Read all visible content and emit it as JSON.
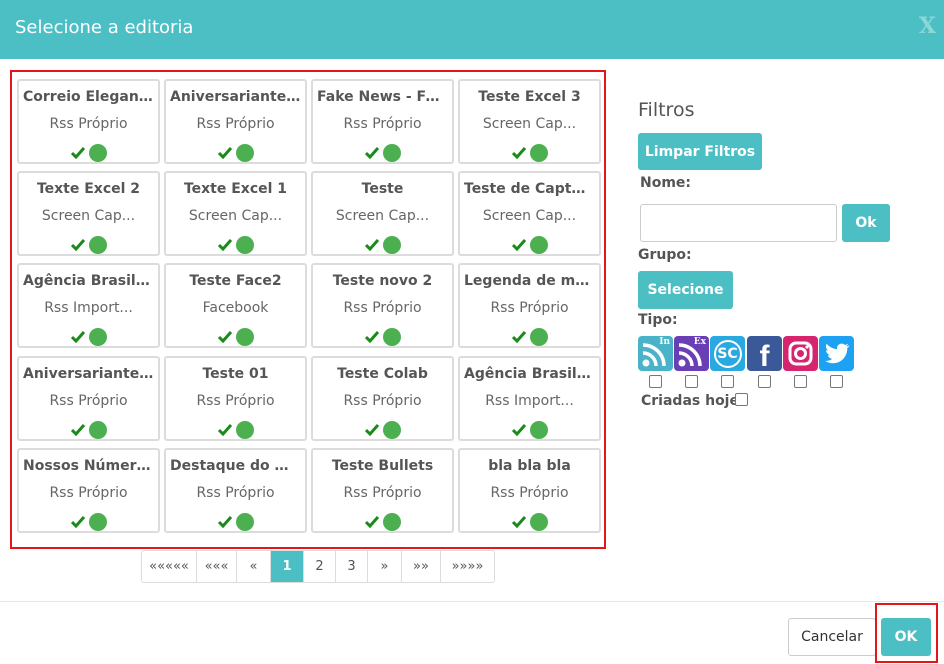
{
  "dialog": {
    "title": "Selecione a editoria",
    "close_label": "X"
  },
  "colors": {
    "accent": "#4bbfc3",
    "highlight": "#e4161b",
    "status_ok": "#4caf50",
    "check": "#1a8a1a"
  },
  "cards": [
    {
      "name": "Correio Elegant...",
      "type": "Rss Próprio"
    },
    {
      "name": "Aniversariantes...",
      "type": "Rss Próprio"
    },
    {
      "name": "Fake News - Fe...",
      "type": "Rss Próprio"
    },
    {
      "name": "Teste Excel 3",
      "type": "Screen Cap..."
    },
    {
      "name": "Texte Excel 2",
      "type": "Screen Cap..."
    },
    {
      "name": "Texte Excel 1",
      "type": "Screen Cap..."
    },
    {
      "name": "Teste",
      "type": "Screen Cap..."
    },
    {
      "name": "Teste de Captur...",
      "type": "Screen Cap..."
    },
    {
      "name": "Agência Brasil - ...",
      "type": "Rss Import..."
    },
    {
      "name": "Teste Face2",
      "type": "Facebook"
    },
    {
      "name": "Teste novo 2",
      "type": "Rss Próprio"
    },
    {
      "name": "Legenda de mol...",
      "type": "Rss Próprio"
    },
    {
      "name": "Aniversariantes...",
      "type": "Rss Próprio"
    },
    {
      "name": "Teste 01",
      "type": "Rss Próprio"
    },
    {
      "name": "Teste Colab",
      "type": "Rss Próprio"
    },
    {
      "name": "Agência Brasil - ...",
      "type": "Rss Import..."
    },
    {
      "name": "Nossos Número...",
      "type": "Rss Próprio"
    },
    {
      "name": "Destaque do M...",
      "type": "Rss Próprio"
    },
    {
      "name": "Teste Bullets",
      "type": "Rss Próprio"
    },
    {
      "name": "bla bla bla",
      "type": "Rss Próprio"
    }
  ],
  "pagination": {
    "items": [
      {
        "label": "«««««",
        "active": false
      },
      {
        "label": "«««",
        "active": false
      },
      {
        "label": "«",
        "active": false
      },
      {
        "label": "1",
        "active": true
      },
      {
        "label": "2",
        "active": false
      },
      {
        "label": "3",
        "active": false
      },
      {
        "label": "»",
        "active": false
      },
      {
        "label": "»»",
        "active": false
      },
      {
        "label": "»»»»",
        "active": false
      }
    ]
  },
  "filters": {
    "title": "Filtros",
    "clear_label": "Limpar Filtros",
    "name_label": "Nome:",
    "name_value": "",
    "name_ok_label": "Ok",
    "group_label": "Grupo:",
    "group_button_label": "Selecione",
    "type_label": "Tipo:",
    "types": [
      {
        "icon": "rss-import-icon",
        "badge": "In",
        "color": "#4bb3c7"
      },
      {
        "icon": "rss-export-icon",
        "badge": "Ex",
        "color": "#6a3fb5"
      },
      {
        "icon": "screen-capture-icon",
        "badge": "SC",
        "color": "#2aa8e0"
      },
      {
        "icon": "facebook-icon",
        "badge": "f",
        "color": "#3b5998"
      },
      {
        "icon": "instagram-icon",
        "badge": "",
        "color": "#d6246e"
      },
      {
        "icon": "twitter-icon",
        "badge": "",
        "color": "#1da1f2"
      }
    ],
    "created_today_label": "Criadas hoje"
  },
  "footer": {
    "cancel_label": "Cancelar",
    "ok_label": "OK"
  }
}
